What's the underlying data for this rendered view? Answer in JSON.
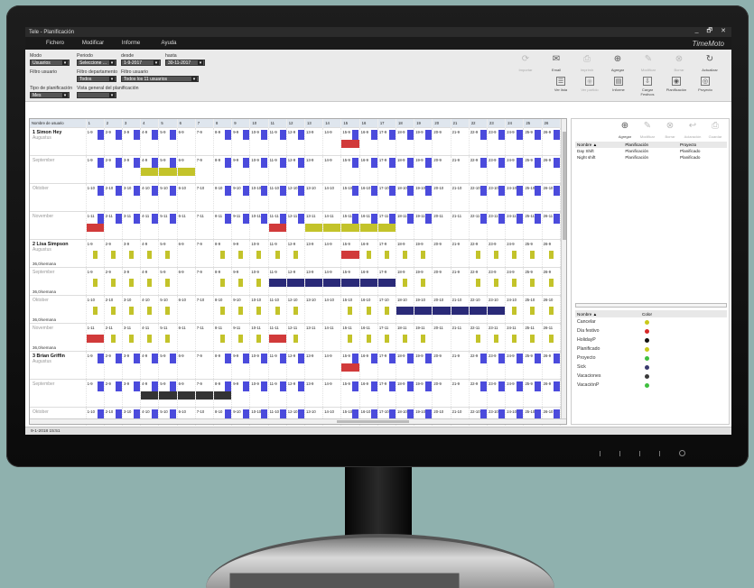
{
  "window": {
    "title": "Tele - Planificación",
    "controls": [
      "_",
      "🗗",
      "✕"
    ]
  },
  "menu": {
    "items": [
      "Fichero",
      "Modificar",
      "Informe",
      "Ayuda"
    ],
    "brand": "TimeMoto"
  },
  "filters": {
    "modo_label": "Modo",
    "modo_value": "Usuarios",
    "periodo_label": "Periodo",
    "periodo_value": "Seleccione ...",
    "desde_label": "desde",
    "desde_value": "1-9-2017",
    "hasta_label": "hasta",
    "hasta_value": "30-11-2017",
    "filtro_usuario_label": "Filtro usuario",
    "filtro_depto_label": "Filtro departamento",
    "filtro_depto_value": "Todos",
    "filtro_usuario2_label": "Filtro usuario",
    "filtro_usuario2_value": "Todos los 11 usuarios",
    "tipo_label": "Tipo de planificación",
    "tipo_value": "Mes",
    "vista_label": "Vista general del planificación",
    "vista_value": ""
  },
  "toolbar_top": [
    {
      "label": "Importar",
      "icon": "import-icon",
      "glyph": "⟳",
      "disabled": true
    },
    {
      "label": "Email",
      "icon": "email-icon",
      "glyph": "✉",
      "disabled": false
    },
    {
      "label": "Imprimir",
      "icon": "printer-icon",
      "glyph": "⎙",
      "disabled": true
    },
    {
      "label": "Agregar",
      "icon": "add-icon",
      "glyph": "⊕",
      "disabled": false
    },
    {
      "label": "Modificar",
      "icon": "edit-icon",
      "glyph": "✎",
      "disabled": true
    },
    {
      "label": "Borrar",
      "icon": "delete-icon",
      "glyph": "⊗",
      "disabled": true
    },
    {
      "label": "Actualizar",
      "icon": "refresh-icon",
      "glyph": "↻",
      "disabled": false
    }
  ],
  "toolbar_bottom": [
    {
      "label": "Ver lista",
      "icon": "list-icon",
      "glyph": "☰",
      "disabled": false
    },
    {
      "label": "Ver partido",
      "icon": "view-icon",
      "glyph": "◉",
      "disabled": true
    },
    {
      "label": "Informe",
      "icon": "report-icon",
      "glyph": "▤",
      "disabled": false
    },
    {
      "label": "Cargar Festivos",
      "icon": "download-icon",
      "glyph": "⇩",
      "disabled": false
    },
    {
      "label": "Planificación",
      "icon": "eye-icon",
      "glyph": "◉",
      "disabled": false
    },
    {
      "label": "Proyecto",
      "icon": "eye-outline-icon",
      "glyph": "◎",
      "disabled": false
    }
  ],
  "grid": {
    "header_name": "Nombre de usuario",
    "days": [
      "1",
      "2",
      "3",
      "4",
      "5",
      "6",
      "7",
      "8",
      "9",
      "10",
      "11",
      "12",
      "13",
      "14",
      "15",
      "16",
      "17",
      "18",
      "19",
      "20",
      "21",
      "22",
      "23",
      "24",
      "25",
      "26"
    ],
    "rows": [
      {
        "name": "1 Simon Hey",
        "sub": "Augustus",
        "month": 9,
        "hrs": ""
      },
      {
        "name": "",
        "sub": "September",
        "month": 9,
        "hrs": ""
      },
      {
        "name": "",
        "sub": "Oktober",
        "month": 10,
        "hrs": ""
      },
      {
        "name": "",
        "sub": "November",
        "month": 11,
        "hrs": ""
      },
      {
        "name": "2 Lisa Simpson",
        "sub": "Augustus",
        "month": 9,
        "hrs": "36,0/semana"
      },
      {
        "name": "",
        "sub": "September",
        "month": 9,
        "hrs": "36,0/semana"
      },
      {
        "name": "",
        "sub": "Oktober",
        "month": 10,
        "hrs": "36,0/semana"
      },
      {
        "name": "",
        "sub": "November",
        "month": 11,
        "hrs": "36,0/semana"
      },
      {
        "name": "3 Brian Griffin",
        "sub": "Augustus",
        "month": 9,
        "hrs": ""
      },
      {
        "name": "",
        "sub": "September",
        "month": 9,
        "hrs": ""
      },
      {
        "name": "",
        "sub": "Oktober",
        "month": 10,
        "hrs": ""
      },
      {
        "name": "",
        "sub": "November",
        "month": 11,
        "hrs": ""
      }
    ]
  },
  "right_toolbar": [
    {
      "label": "Agregar",
      "glyph": "⊕",
      "icon": "add-icon",
      "disabled": false
    },
    {
      "label": "Modificar",
      "glyph": "✎",
      "icon": "edit-icon",
      "disabled": true
    },
    {
      "label": "Borrar",
      "glyph": "⊗",
      "icon": "delete-icon",
      "disabled": true
    },
    {
      "label": "Aclaración",
      "glyph": "↩",
      "icon": "undo-icon",
      "disabled": true
    },
    {
      "label": "Guardar",
      "glyph": "⎙",
      "icon": "save-icon",
      "disabled": true
    }
  ],
  "plan_table": {
    "headers": [
      "Nombre ▲",
      "Planificación",
      "Proyecto"
    ],
    "rows": [
      [
        "Day Shift",
        "Planificación",
        "Planificado"
      ],
      [
        "Night shift",
        "Planificación",
        "Planificado"
      ]
    ]
  },
  "color_legend": {
    "headers": [
      "Nombre ▲",
      "Color"
    ],
    "items": [
      {
        "name": "Cancelar",
        "color": "#c9c91a"
      },
      {
        "name": "Día festivo",
        "color": "#d62828"
      },
      {
        "name": "HolidayP",
        "color": "#111111"
      },
      {
        "name": "Planificado",
        "color": "#c9c91a"
      },
      {
        "name": "Proyecto",
        "color": "#3fbf3f"
      },
      {
        "name": "Sick",
        "color": "#3a3a6e"
      },
      {
        "name": "Vacaciones",
        "color": "#3a3a3a"
      },
      {
        "name": "VacaciónP",
        "color": "#3fbf3f"
      }
    ]
  },
  "status": {
    "text": "9-1-2018 15:51"
  },
  "colors": {
    "blue": "#4b4bdc",
    "yellow": "#c3c32a",
    "red": "#d13a3a",
    "navy": "#2a2a78",
    "dark": "#333333"
  }
}
